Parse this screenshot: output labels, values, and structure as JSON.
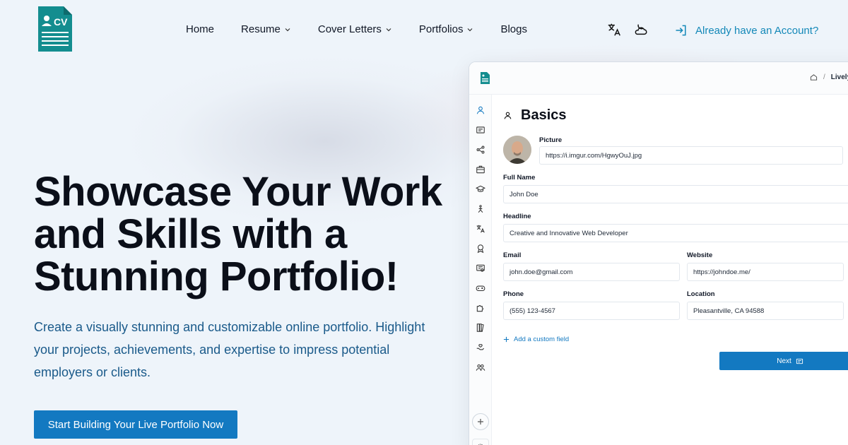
{
  "header": {
    "nav": [
      {
        "label": "Home",
        "dropdown": false
      },
      {
        "label": "Resume",
        "dropdown": true
      },
      {
        "label": "Cover Letters",
        "dropdown": true
      },
      {
        "label": "Portfolios",
        "dropdown": true
      },
      {
        "label": "Blogs",
        "dropdown": false
      }
    ],
    "login_label": "Already have an Account?",
    "logo_text": "CV"
  },
  "hero": {
    "title_lines": [
      "Showcase Your Work",
      "and Skills with a",
      "Stunning Portfolio!"
    ],
    "subtitle_lines": [
      "Create a visually stunning and customizable online portfolio. Highlight",
      "your projects, achievements, and expertise to impress potential",
      "employers or clients."
    ],
    "cta_label": "Start Building Your Live Portfolio Now"
  },
  "app": {
    "breadcrumb": [
      "/",
      "Lively"
    ],
    "section_title": "Basics",
    "fields": {
      "picture": {
        "label": "Picture",
        "value": "https://i.imgur.com/HgwyOuJ.jpg"
      },
      "full_name": {
        "label": "Full Name",
        "value": "John Doe"
      },
      "headline": {
        "label": "Headline",
        "value": "Creative and Innovative Web Developer"
      },
      "email": {
        "label": "Email",
        "value": "john.doe@gmail.com"
      },
      "website": {
        "label": "Website",
        "value": "https://johndoe.me/"
      },
      "phone": {
        "label": "Phone",
        "value": "(555) 123-4567"
      },
      "location": {
        "label": "Location",
        "value": "Pleasantville, CA 94588"
      }
    },
    "add_custom_field_label": "Add a custom field",
    "next_label": "Next",
    "sidebar_icons": [
      "user-icon",
      "document-icon",
      "share-icon",
      "briefcase-icon",
      "graduation-cap-icon",
      "skills-icon",
      "translate-icon",
      "award-icon",
      "certificate-icon",
      "gamepad-icon",
      "puzzle-icon",
      "books-icon",
      "volunteer-icon",
      "users-icon"
    ]
  },
  "colors": {
    "accent": "#1379c1",
    "brand_teal": "#138d8f",
    "link": "#1388b8",
    "subtitle": "#1a5a8a"
  }
}
